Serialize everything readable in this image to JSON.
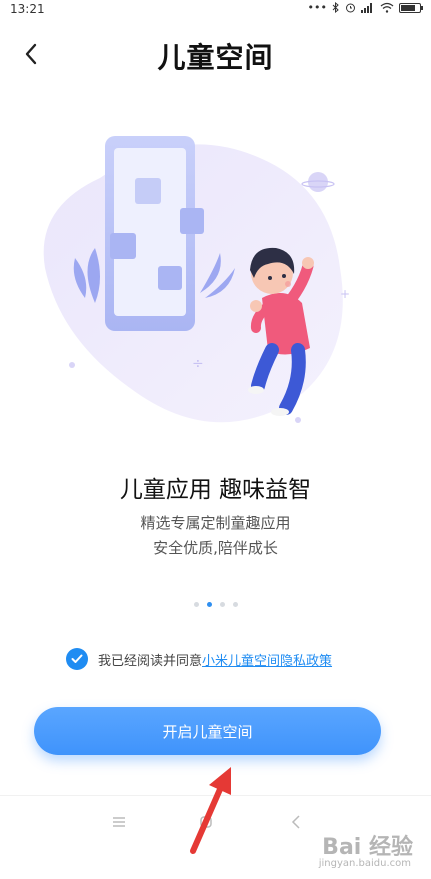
{
  "status": {
    "time": "13:21",
    "icons": [
      "more-dots-icon",
      "bluetooth-icon",
      "alarm-icon",
      "signal-icon",
      "wifi-icon",
      "battery-icon"
    ]
  },
  "header": {
    "title": "儿童空间",
    "back_icon": "chevron-left-icon"
  },
  "feature": {
    "headline": "儿童应用 趣味益智",
    "description_line1": "精选专属定制童趣应用",
    "description_line2": "安全优质,陪伴成长"
  },
  "pager": {
    "total": 4,
    "active_index": 1
  },
  "agreement": {
    "checked": true,
    "text": "我已经阅读并同意",
    "link_text": "小米儿童空间隐私政策"
  },
  "actions": {
    "start_label": "开启儿童空间"
  },
  "nav": {
    "icons": [
      "menu-icon",
      "home-icon",
      "back-icon"
    ]
  },
  "watermark": {
    "brand": "Bai 经验",
    "url": "jingyan.baidu.com"
  },
  "colors": {
    "accent": "#1f8cf2",
    "button": "#4a9bfd",
    "illustration_blob": "#e9e7fb"
  }
}
